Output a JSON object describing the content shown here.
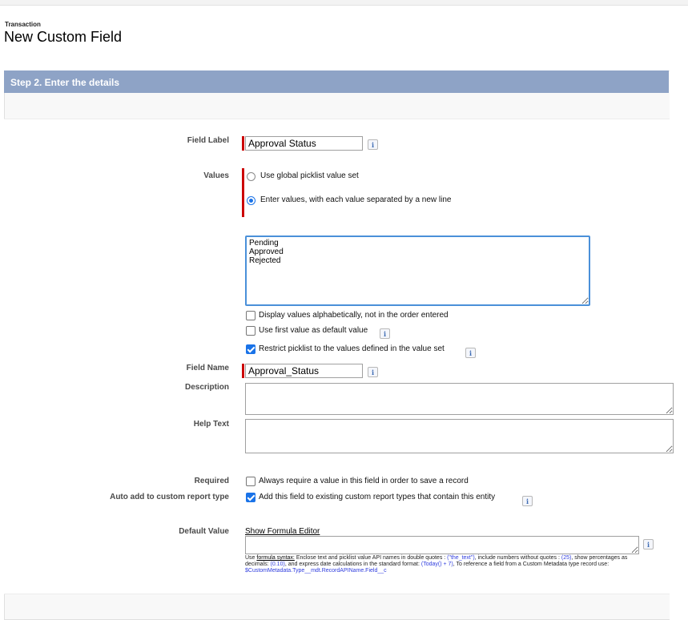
{
  "header": {
    "object_label": "Transaction",
    "title": "New Custom Field"
  },
  "step": {
    "title": "Step 2. Enter the details"
  },
  "form": {
    "field_label": {
      "label": "Field Label",
      "value": "Approval Status"
    },
    "values": {
      "label": "Values",
      "options": [
        {
          "label": "Use global picklist value set",
          "selected": false
        },
        {
          "label": "Enter values, with each value separated by a new line",
          "selected": true
        }
      ],
      "entries": "Pending\nApproved\nRejected",
      "checkboxes": [
        {
          "label": "Display values alphabetically, not in the order entered",
          "checked": false
        },
        {
          "label": "Use first value as default value",
          "checked": false
        },
        {
          "label": "Restrict picklist to the values defined in the value set",
          "checked": true
        }
      ]
    },
    "field_name": {
      "label": "Field Name",
      "value": "Approval_Status"
    },
    "description": {
      "label": "Description",
      "value": ""
    },
    "help_text": {
      "label": "Help Text",
      "value": ""
    },
    "required": {
      "label": "Required",
      "checkbox_label": "Always require a value in this field in order to save a record",
      "checked": false
    },
    "auto_add": {
      "label": "Auto add to custom report type",
      "checkbox_label": "Add this field to existing custom report types that contain this entity",
      "checked": true
    },
    "default_value": {
      "label": "Default Value",
      "link": "Show Formula Editor",
      "value": "",
      "hint": {
        "use": "Use ",
        "formula_syntax": "formula syntax:",
        "part1": " Enclose text and picklist value API names in double quotes : ",
        "ex_text": "(\"the_text\")",
        "part2": ", include numbers without quotes : ",
        "ex_number": "(25)",
        "part3": ", show percentages as decimals: ",
        "ex_percent": "(0.10)",
        "part4": ", and express date calculations in the standard format: ",
        "ex_date": "(Today() + 7)",
        "part5": ", To reference a field from a Custom Metadata type record use: ",
        "ex_metadata": "$CustomMetadata.Type__mdt.RecordAPIName.Field__c"
      }
    }
  },
  "icons": {
    "info": "i"
  },
  "colors": {
    "header_bar": "#8ea3c6",
    "required_marker": "#cc0000",
    "accent": "#1a73e8",
    "hint_blue": "#2f3dde"
  }
}
